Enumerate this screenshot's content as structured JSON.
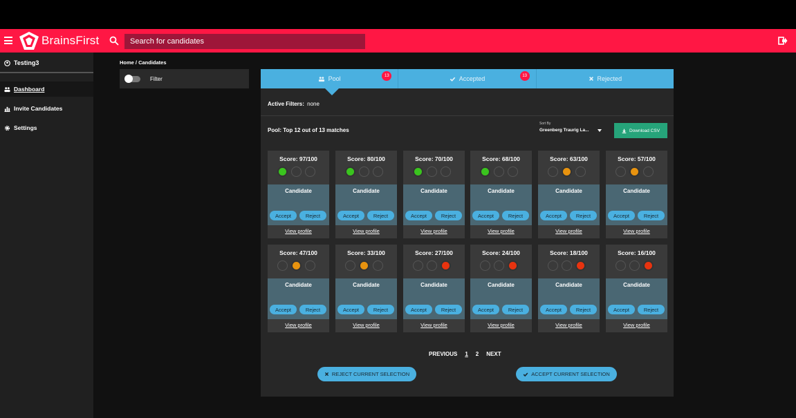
{
  "header": {
    "brand": "BrainsFirst",
    "search_placeholder": "Search for candidates",
    "accent": "#ff1744"
  },
  "sidebar": {
    "user": "Testing3",
    "items": [
      {
        "label": "Dashboard",
        "icon": "users-icon",
        "active": true
      },
      {
        "label": "Invite Candidates",
        "icon": "chart-icon",
        "active": false
      },
      {
        "label": "Settings",
        "icon": "gear-icon",
        "active": false
      }
    ]
  },
  "main": {
    "breadcrumb": "Home / Candidates",
    "filter_label": "Filter",
    "tabs": [
      {
        "label": "Pool",
        "icon": "users-icon",
        "badge": "13"
      },
      {
        "label": "Accepted",
        "icon": "check-icon",
        "badge": "13"
      },
      {
        "label": "Rejected",
        "icon": "close-icon",
        "badge": ""
      }
    ],
    "active_filters_label": "Active Filters:",
    "active_filters_value": "none",
    "pool_summary": "Pool: Top 12 out of 13 matches",
    "sort_label": "Sort By",
    "sort_value": "Greenberg Traurig La...",
    "download_label": "Download CSV",
    "card_title": "Candidate",
    "accept_label": "Accept",
    "reject_label": "Reject",
    "view_label": "View profile",
    "cards": [
      {
        "score": "Score: 97/100",
        "level": 1
      },
      {
        "score": "Score: 80/100",
        "level": 1
      },
      {
        "score": "Score: 70/100",
        "level": 1
      },
      {
        "score": "Score: 68/100",
        "level": 1
      },
      {
        "score": "Score: 63/100",
        "level": 2
      },
      {
        "score": "Score: 57/100",
        "level": 2
      },
      {
        "score": "Score: 47/100",
        "level": 2
      },
      {
        "score": "Score: 33/100",
        "level": 2
      },
      {
        "score": "Score: 27/100",
        "level": 3
      },
      {
        "score": "Score: 24/100",
        "level": 3
      },
      {
        "score": "Score: 18/100",
        "level": 3
      },
      {
        "score": "Score: 16/100",
        "level": 3
      }
    ],
    "level_colors": {
      "1": "#3ac41e",
      "2": "#e8930f",
      "3": "#e8330f"
    },
    "pagination": {
      "previous": "PREVIOUS",
      "pages": [
        "1",
        "2"
      ],
      "next": "NEXT"
    },
    "reject_selection": "REJECT CURRENT SELECTION",
    "accept_selection": "ACCEPT CURRENT SELECTION"
  }
}
